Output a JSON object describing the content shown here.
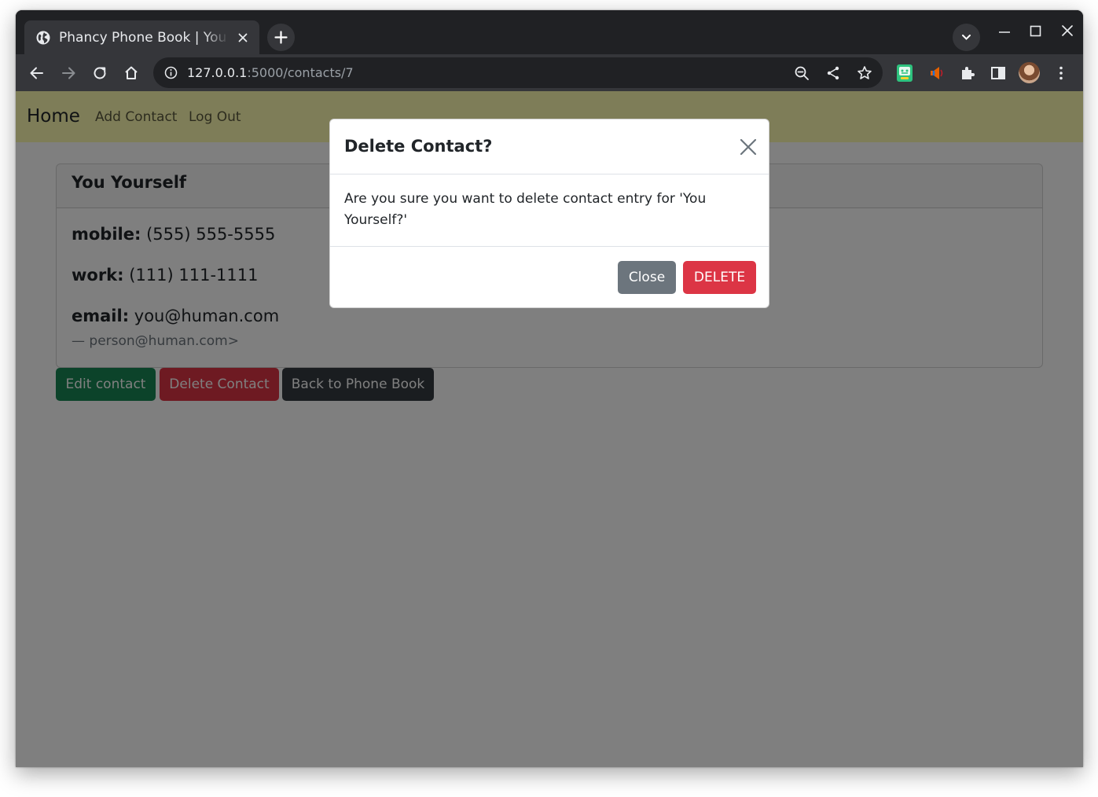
{
  "browser": {
    "tab_title": "Phancy Phone Book | You",
    "url_host": "127.0.0.1",
    "url_path": ":5000/contacts/7"
  },
  "nav": {
    "brand": "Home",
    "links": [
      "Add Contact",
      "Log Out"
    ]
  },
  "contact": {
    "name": "You Yourself",
    "mobile_label": "mobile:",
    "mobile": "(555) 555-5555",
    "work_label": "work:",
    "work": "(111) 111-1111",
    "email_label": "email:",
    "email": "you@human.com",
    "owner": "— person@human.com>"
  },
  "actions": {
    "edit": "Edit contact",
    "delete": "Delete Contact",
    "back": "Back to Phone Book"
  },
  "modal": {
    "title": "Delete Contact?",
    "body": "Are you sure you want to delete contact entry for 'You Yourself?'",
    "close": "Close",
    "confirm": "DELETE"
  },
  "colors": {
    "navbar": "#fdfab0",
    "success": "#198754",
    "danger": "#dc3545",
    "secondary": "#6c757d",
    "dark": "#343a40"
  }
}
